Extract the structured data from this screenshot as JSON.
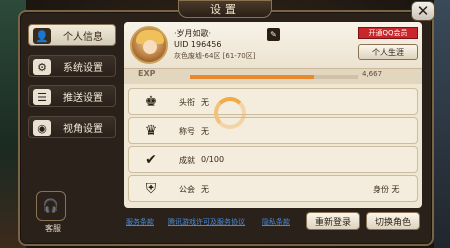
{
  "window": {
    "title": "设置"
  },
  "sidebar": {
    "items": [
      {
        "label": "个人信息",
        "icon": "person-icon",
        "active": true
      },
      {
        "label": "系统设置",
        "icon": "gear-icon",
        "active": false
      },
      {
        "label": "推送设置",
        "icon": "message-icon",
        "active": false
      },
      {
        "label": "视角设置",
        "icon": "eye-icon",
        "active": false
      }
    ],
    "customer_service_label": "客服"
  },
  "profile": {
    "name": "·岁月如歌·",
    "uid": "UID 196456",
    "server": "灰色废墟-64区 [61-70区]",
    "vip_button": "开通QQ会员",
    "career_button": "个人生涯",
    "exp_label": "EXP",
    "exp_value": "4,667",
    "exp_progress": 0.74
  },
  "rows": [
    {
      "label": "头衔",
      "value": "无",
      "icon": "title-emblem-icon"
    },
    {
      "label": "称号",
      "value": "无",
      "icon": "crown-icon"
    },
    {
      "label": "成就",
      "value": "0/100",
      "icon": "achievement-check-icon"
    },
    {
      "label": "公会",
      "value": "无",
      "right_label": "身份",
      "right_value": "无",
      "icon": "guild-shield-icon"
    }
  ],
  "footer": {
    "links": [
      "服务条款",
      "腾讯游戏许可及服务协议",
      "隐私条款"
    ],
    "buttons": [
      "重新登录",
      "切换角色"
    ]
  },
  "colors": {
    "accent_orange": "#e8892e",
    "vip_red": "#c8262a",
    "panel_cream": "#efe6d4",
    "link_blue": "#4a8ad4"
  }
}
